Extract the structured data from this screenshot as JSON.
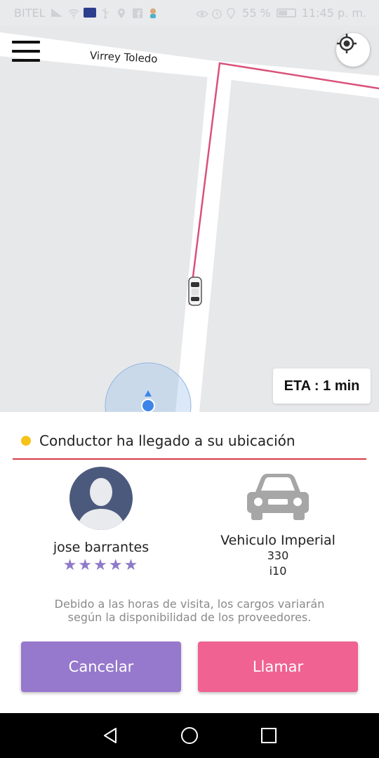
{
  "status_bar": {
    "carrier": "BITEL",
    "battery": "55 %",
    "time": "11:45 p. m."
  },
  "map": {
    "street_name": "Virrey Toledo",
    "eta": "ETA : 1 min"
  },
  "ride_status": {
    "text": "Conductor ha llegado a su ubicación",
    "dot_color": "#f5c318"
  },
  "driver": {
    "name": "jose barrantes",
    "rating": 5,
    "stars": "★★★★★"
  },
  "vehicle": {
    "name": "Vehiculo Imperial",
    "number": "330",
    "model": "i10"
  },
  "notice": {
    "line1": "Debido a las horas de visita, los cargos variarán",
    "line2": "según la disponibilidad de los proveedores."
  },
  "actions": {
    "cancel_label": "Cancelar",
    "call_label": "Llamar"
  },
  "colors": {
    "cancel": "#9678cc",
    "call": "#ef6291",
    "route": "#d9527a",
    "divider": "#d53b46"
  }
}
